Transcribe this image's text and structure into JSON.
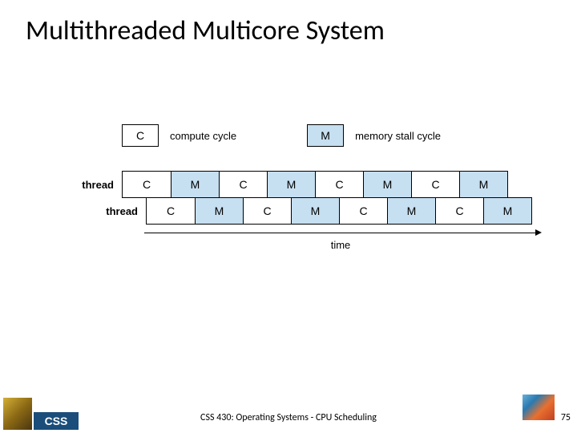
{
  "title": "Multithreaded Multicore System",
  "legend": {
    "c_symbol": "C",
    "c_label": "compute cycle",
    "m_symbol": "M",
    "m_label": "memory stall cycle"
  },
  "threads": {
    "label1": "thread",
    "label2": "thread",
    "row1": [
      "C",
      "M",
      "C",
      "M",
      "C",
      "M",
      "C",
      "M"
    ],
    "row2": [
      "C",
      "M",
      "C",
      "M",
      "C",
      "M",
      "C",
      "M"
    ]
  },
  "axis": {
    "label": "time"
  },
  "footer": {
    "css_logo": "CSS",
    "text": "CSS 430: Operating Systems - CPU Scheduling",
    "page": "75"
  }
}
